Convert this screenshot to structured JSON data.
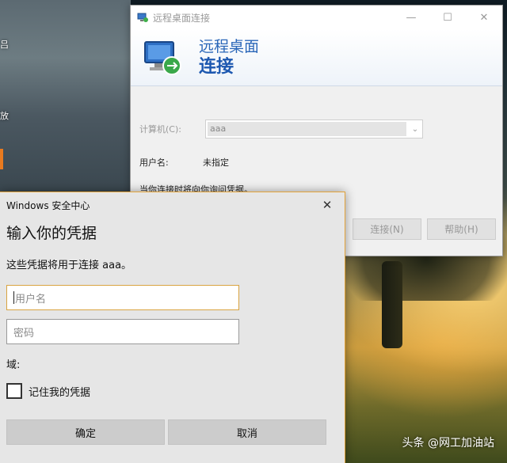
{
  "desktop": {
    "labels": [
      "吕",
      "放"
    ],
    "watermark": "头条 @网工加油站"
  },
  "rdp_window": {
    "title": "远程桌面连接",
    "banner_line1": "远程桌面",
    "banner_line2": "连接",
    "computer_label": "计算机(C):",
    "computer_value": "aaa",
    "username_label": "用户名:",
    "username_value": "未指定",
    "prompt_text": "当你连接时将向你询问凭据。",
    "connect_button": "连接(N)",
    "help_button": "帮助(H)",
    "minimize_icon": "minimize-icon",
    "maximize_icon": "maximize-icon",
    "close_icon": "close-icon"
  },
  "security_dialog": {
    "title": "Windows 安全中心",
    "heading": "输入你的凭据",
    "description": "这些凭据将用于连接 aaa。",
    "username_placeholder": "用户名",
    "password_placeholder": "密码",
    "domain_label": "域:",
    "remember_label": "记住我的凭据",
    "remember_checked": false,
    "ok_button": "确定",
    "cancel_button": "取消",
    "accent_color": "#e3a33a"
  }
}
